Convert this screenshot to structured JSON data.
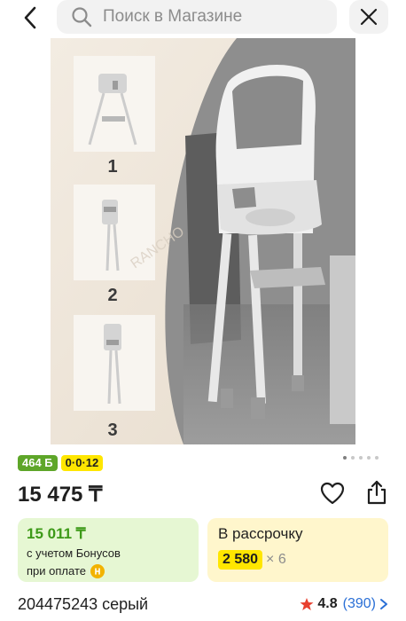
{
  "search": {
    "placeholder": "Поиск в Магазине"
  },
  "badges": {
    "bonus": "464 Б",
    "split": "0·0·12"
  },
  "product": {
    "price": "15 475 ₸",
    "title": "204475243 серый",
    "rating": "4.8",
    "reviews": "(390)"
  },
  "bonus_card": {
    "price": "15 011 ₸",
    "line1": "с учетом Бонусов",
    "line2": "при оплате"
  },
  "installment_card": {
    "title": "В рассрочку",
    "amount": "2 580",
    "times": "× 6"
  },
  "image": {
    "steps": [
      "1",
      "2",
      "3"
    ],
    "watermark": "RANCHO"
  },
  "colors": {
    "bonus_green": "#5ea629",
    "split_yellow": "#ffe600",
    "star": "#e8402f",
    "link_blue": "#2a6fd6"
  },
  "icons": [
    "back-arrow-icon",
    "search-icon",
    "close-icon",
    "heart-icon",
    "share-icon",
    "star-icon",
    "chevron-right-icon",
    "coin-icon"
  ]
}
